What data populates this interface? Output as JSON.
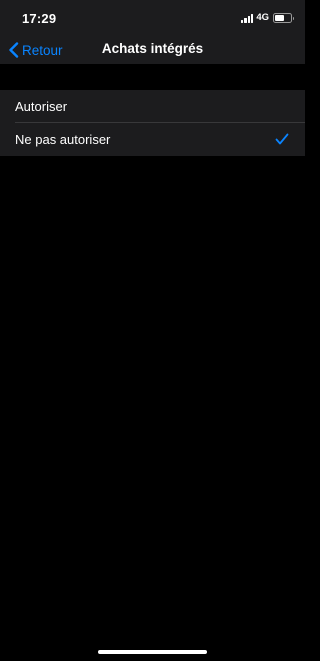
{
  "status_bar": {
    "time": "17:29",
    "network": "4G",
    "signal_bars": 4,
    "battery_level": 0.6
  },
  "nav": {
    "back_label": "Retour",
    "title": "Achats intégrés"
  },
  "options": [
    {
      "label": "Autoriser",
      "selected": false
    },
    {
      "label": "Ne pas autoriser",
      "selected": true
    }
  ],
  "colors": {
    "accent": "#0a84ff",
    "background": "#000000",
    "cell": "#1c1c1e",
    "separator": "#38383a"
  },
  "icons": {
    "back": "chevron-left-icon",
    "selected": "checkmark-icon",
    "signal": "cellular-signal-icon",
    "battery": "battery-icon"
  }
}
